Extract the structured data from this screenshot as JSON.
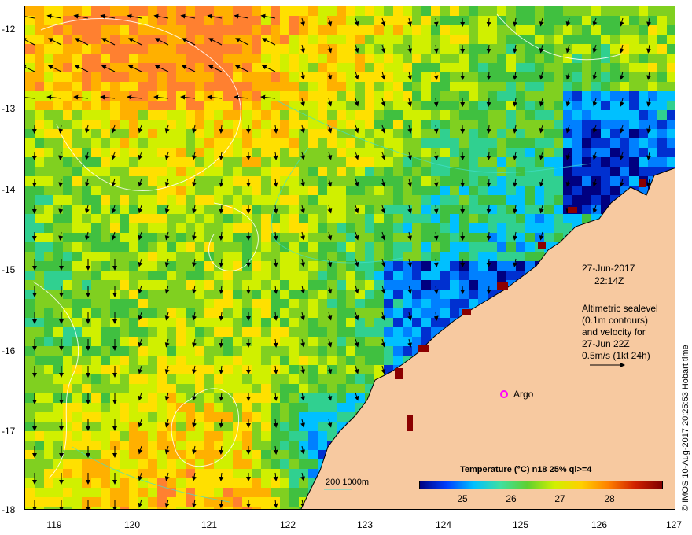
{
  "map": {
    "date": "27-Jun-2017",
    "time": "22:14Z",
    "annotation_lines": [
      "Altimetric sealevel",
      "(0.1m contours)",
      "and velocity for",
      "27-Jun 22Z",
      "0.5m/s (1kt 24h)"
    ],
    "float_label": "Argo",
    "bathy_label": "200  1000m",
    "credit": "© IMOS 10-Aug-2017 20:25:53 Hobart time",
    "lat_ticks": [
      "-12",
      "-13",
      "-14",
      "-15",
      "-16",
      "-17",
      "-18"
    ],
    "lon_ticks": [
      "119",
      "120",
      "121",
      "122",
      "123",
      "124",
      "125",
      "126",
      "127"
    ],
    "colorbar": {
      "title": "Temperature (°C) n18 25% ql>=4",
      "labels": [
        "25",
        "26",
        "27",
        "28"
      ],
      "colors": [
        "#000080",
        "#0040ff",
        "#00c0ff",
        "#40e0a0",
        "#60d030",
        "#d0f000",
        "#ffd000",
        "#ff8000",
        "#d02000",
        "#800000"
      ]
    },
    "colors": {
      "land": "#f7c9a0",
      "coast": "#000000",
      "argo_marker": "#ff00ff",
      "contour": "#ffffff",
      "bathymetry": "#40e0d0"
    }
  }
}
